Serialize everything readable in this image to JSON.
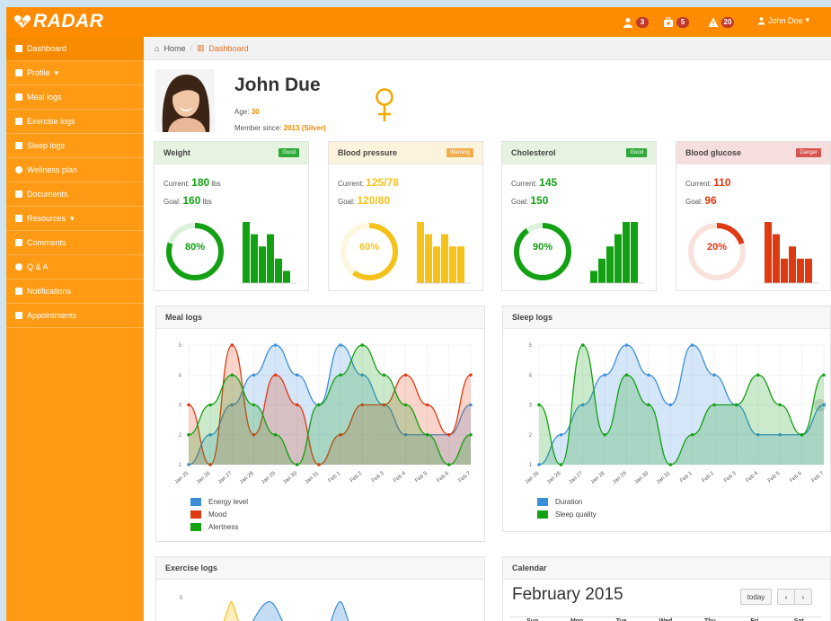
{
  "app": {
    "brand": "RADAR"
  },
  "topbar": {
    "badges": [
      {
        "icon": "user-icon",
        "count": "3"
      },
      {
        "icon": "medkit-icon",
        "count": "5"
      },
      {
        "icon": "warning-icon",
        "count": "20"
      }
    ],
    "user_label": "John Doe",
    "accent": "#ff8c00"
  },
  "sidebar": {
    "items": [
      {
        "label": "Dashboard",
        "icon": "bar-chart-icon",
        "name": "sidebar-item-dashboard"
      },
      {
        "label": "Profile",
        "icon": "user-icon",
        "name": "sidebar-item-profile",
        "caret": true
      },
      {
        "label": "Meal logs",
        "icon": "cutlery-icon",
        "name": "sidebar-item-meal-logs"
      },
      {
        "label": "Exercise logs",
        "icon": "figure-icon",
        "name": "sidebar-item-exercise-logs"
      },
      {
        "label": "Sleep logs",
        "icon": "bed-icon",
        "name": "sidebar-item-sleep-logs"
      },
      {
        "label": "Wellness plan",
        "icon": "dashboard-icon",
        "name": "sidebar-item-wellness-plan"
      },
      {
        "label": "Documents",
        "icon": "document-icon",
        "name": "sidebar-item-documents"
      },
      {
        "label": "Resources",
        "icon": "book-icon",
        "name": "sidebar-item-resources",
        "caret": true
      },
      {
        "label": "Comments",
        "icon": "comment-icon",
        "name": "sidebar-item-comments"
      },
      {
        "label": "Q & A",
        "icon": "question-icon",
        "name": "sidebar-item-qa"
      },
      {
        "label": "Notifications",
        "icon": "warning-icon",
        "name": "sidebar-item-notifications"
      },
      {
        "label": "Appointments",
        "icon": "user-icon",
        "name": "sidebar-item-appointments"
      }
    ]
  },
  "breadcrumb": {
    "home": "Home",
    "current": "Dashboard"
  },
  "profile": {
    "name": "John Due",
    "age_label": "Age:",
    "age": "30",
    "member_label": "Member since:",
    "member_value": "2013 (Silver)"
  },
  "cards": [
    {
      "title": "Weight",
      "status": "Good",
      "status_color": "#2eaa3a",
      "current_label": "Current:",
      "current": "180",
      "current_unit": "lbs",
      "goal_label": "Goal:",
      "goal": "160",
      "goal_unit": "lbs",
      "percent": 80,
      "percent_label": "80%",
      "color": "#13a013",
      "head_bg": "#e5f3e0",
      "bars": [
        5,
        4,
        3,
        4,
        2,
        1
      ]
    },
    {
      "title": "Blood pressure",
      "status": "Warning",
      "status_color": "#f0ad4e",
      "current_label": "Current:",
      "current": "125/78",
      "current_unit": "",
      "goal_label": "Goal:",
      "goal": "120/80",
      "goal_unit": "",
      "percent": 60,
      "percent_label": "60%",
      "color": "#f5c21b",
      "head_bg": "#fcf3dd",
      "bars": [
        5,
        4,
        3,
        4,
        3,
        3
      ]
    },
    {
      "title": "Cholesterol",
      "status": "Good",
      "status_color": "#2eaa3a",
      "current_label": "Current:",
      "current": "145",
      "current_unit": "",
      "goal_label": "Goal:",
      "goal": "150",
      "goal_unit": "",
      "percent": 90,
      "percent_label": "90%",
      "color": "#13a013",
      "head_bg": "#e5f3e0",
      "bars": [
        1,
        2,
        3,
        4,
        5,
        5
      ]
    },
    {
      "title": "Blood glucose",
      "status": "Danger",
      "status_color": "#d9534f",
      "current_label": "Current:",
      "current": "110",
      "current_unit": "",
      "goal_label": "Goal:",
      "goal": "96",
      "goal_unit": "",
      "percent": 20,
      "percent_label": "20%",
      "color": "#dd3a12",
      "head_bg": "#f7dede",
      "bars": [
        5,
        4,
        2,
        3,
        2,
        2
      ]
    }
  ],
  "panels": {
    "meal_title": "Meal logs",
    "sleep_title": "Sleep logs",
    "exercise_title": "Exercise logs",
    "calendar_title": "Calendar"
  },
  "chart_data": [
    {
      "type": "area",
      "categories": [
        "Jan 25",
        "Jan 26",
        "Jan 27",
        "Jan 28",
        "Jan 29",
        "Jan 30",
        "Jan 31",
        "Feb 1",
        "Feb 2",
        "Feb 3",
        "Feb 4",
        "Feb 5",
        "Feb 6",
        "Feb 7"
      ],
      "ylim": [
        1,
        5
      ],
      "yticks": [
        1,
        2,
        3,
        4,
        5
      ],
      "series": [
        {
          "name": "Energy level",
          "color": "#3b8fd9",
          "values": [
            1,
            2,
            3,
            4,
            5,
            4,
            3,
            5,
            4,
            3,
            2,
            2,
            2,
            3
          ]
        },
        {
          "name": "Mood",
          "color": "#dd3a12",
          "values": [
            3,
            1,
            5,
            2,
            4,
            3,
            1,
            2,
            3,
            3,
            4,
            3,
            2,
            4
          ]
        },
        {
          "name": "Alertness",
          "color": "#13a013",
          "values": [
            2,
            3,
            4,
            3,
            2,
            1,
            3,
            4,
            5,
            4,
            3,
            2,
            1,
            2
          ]
        }
      ]
    },
    {
      "type": "area",
      "categories": [
        "Jan 26",
        "Jan 26",
        "Jan 27",
        "Jan 28",
        "Jan 29",
        "Jan 30",
        "Jan 31",
        "Feb 1",
        "Feb 2",
        "Feb 3",
        "Feb 4",
        "Feb 5",
        "Feb 6",
        "Feb 7"
      ],
      "ylim": [
        1,
        5
      ],
      "yticks": [
        1,
        2,
        3,
        4,
        5
      ],
      "series": [
        {
          "name": "Duration",
          "color": "#3b8fd9",
          "values": [
            1,
            2,
            3,
            4,
            5,
            4,
            3,
            5,
            4,
            3,
            2,
            2,
            2,
            3
          ]
        },
        {
          "name": "Sleep quality",
          "color": "#13a013",
          "values": [
            3,
            1,
            5,
            2,
            4,
            3,
            1,
            2,
            3,
            3,
            4,
            3,
            2,
            4
          ]
        }
      ]
    }
  ],
  "calendar": {
    "month": "February 2015",
    "today_label": "today",
    "prev": "‹",
    "next": "›",
    "days": [
      "Sun",
      "Mon",
      "Tue",
      "Wed",
      "Thu",
      "Fri",
      "Sat"
    ]
  }
}
